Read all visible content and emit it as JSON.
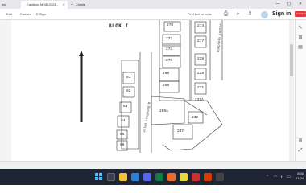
{
  "browser": {
    "inactive_tab_label": "ms",
    "active_tab_label": "Cantikan M-08-2023...",
    "new_tab_label": "Create",
    "minimize_glyph": "—",
    "maximize_glyph": "▢",
    "close_glyph": "✕"
  },
  "toolbar": {
    "menu": [
      "Edit",
      "Convert",
      "E-Sign"
    ],
    "find_label": "Find text or tools",
    "signin_label": "Sign in",
    "ai_badge_label": "AI Assistant"
  },
  "document": {
    "blok_label": "BLOK I",
    "road_label_vertical": "Jalan Lingkung B",
    "road_label_right": "Kompleks Lontar",
    "lots_left_column": [
      "81",
      "82",
      "83",
      "84",
      "85",
      "86"
    ],
    "lots_middle_column": [
      "270",
      "272",
      "273",
      "275",
      "268",
      "268",
      "269A"
    ],
    "lots_right_column": [
      "274",
      "277",
      "229",
      "228",
      "231",
      "231A"
    ],
    "lots_bottom": [
      "232",
      "247"
    ]
  },
  "taskbar": {
    "clock_time": "8:00",
    "clock_date": "11/04"
  }
}
